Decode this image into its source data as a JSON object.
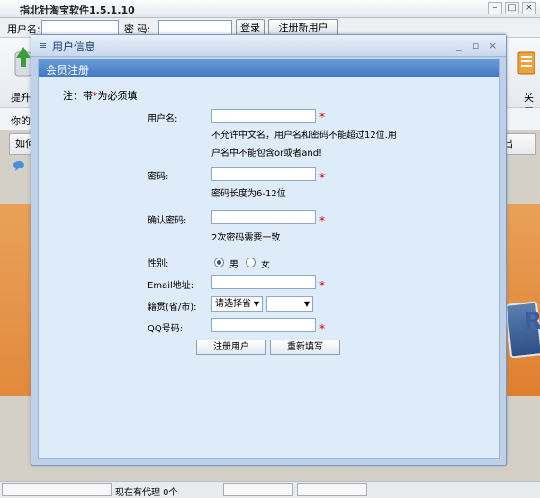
{
  "window": {
    "title": "指北针淘宝软件1.5.1.10"
  },
  "login_bar": {
    "username_label": "用户名:",
    "password_label": "密  码:",
    "login_button": "登录",
    "register_button": "注册新用户"
  },
  "toolbar": {
    "left_label": "提升淘",
    "right_label": "关于"
  },
  "info_text": "你的本",
  "tabs": {
    "left": "如何",
    "right": "出"
  },
  "status_bar": {
    "agents_text": "现在有代理 0个"
  },
  "dialog": {
    "title": "用户信息",
    "section_title": "会员注册",
    "note_prefix": "注：带",
    "note_star": "*",
    "note_suffix": "为必须填",
    "fields": {
      "username_label": "用户名:",
      "username_hint_line1": "不允许中文名，用户名和密码不能超过12位.用",
      "username_hint_line2": "户名中不能包含or或者and!",
      "password_label": "密码:",
      "password_hint": "密码长度为6-12位",
      "confirm_label": "确认密码:",
      "confirm_hint": "2次密码需要一致",
      "gender_label": "性别:",
      "gender_male": "男",
      "gender_female": "女",
      "email_label": "Email地址:",
      "region_label": "籍贯(省/市):",
      "province_select": "请选择省",
      "city_select": "",
      "qq_label": "QQ号码:"
    },
    "required_mark": "*",
    "buttons": {
      "register": "注册用户",
      "reset": "重新填写"
    }
  },
  "colors": {
    "section_bar": "#3f77c3",
    "required": "#d20000",
    "dialog_bg": "#deebf8"
  }
}
